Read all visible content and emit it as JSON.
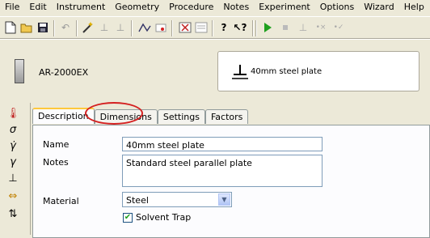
{
  "menu": [
    "File",
    "Edit",
    "Instrument",
    "Geometry",
    "Procedure",
    "Notes",
    "Experiment",
    "Options",
    "Wizard",
    "Help"
  ],
  "instrument": {
    "name": "AR-2000EX"
  },
  "geometry": {
    "name": "40mm steel plate"
  },
  "tabs": [
    "Description",
    "Dimensions",
    "Settings",
    "Factors"
  ],
  "form": {
    "name_label": "Name",
    "name_value": "40mm steel plate",
    "notes_label": "Notes",
    "notes_value": "Standard steel parallel plate",
    "material_label": "Material",
    "material_value": "Steel",
    "solvent_label": "Solvent Trap",
    "solvent_checked": true
  },
  "colors": {
    "highlight": "#d42020",
    "tab_accent": "#ffc83c",
    "play": "#1ea01e"
  }
}
